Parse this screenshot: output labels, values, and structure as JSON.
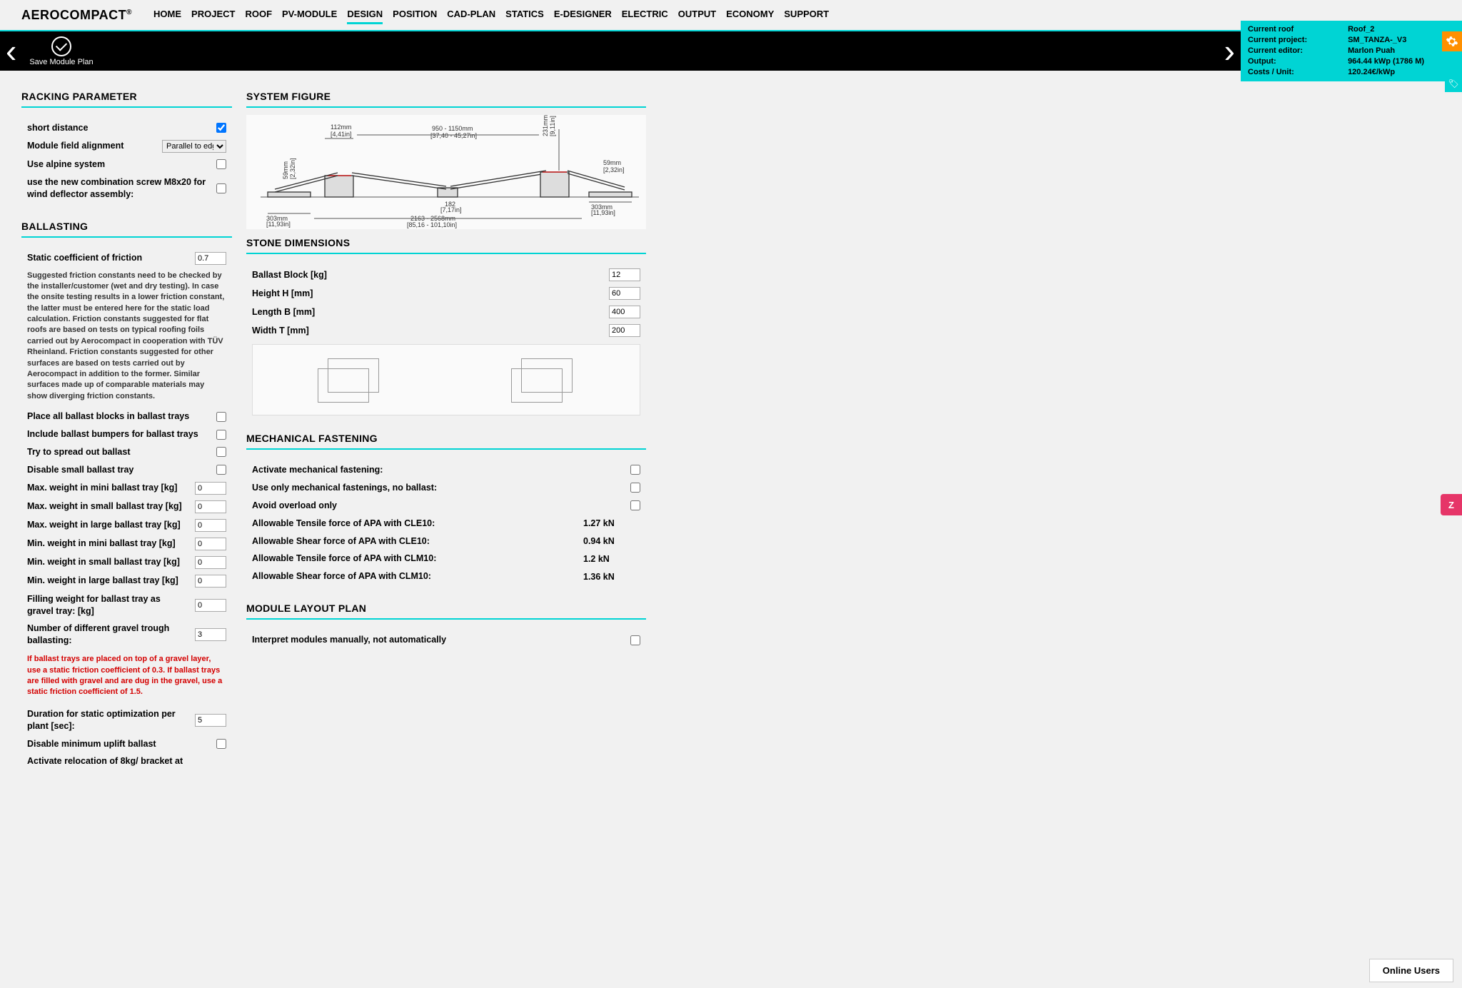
{
  "brand": "AEROCOMPACT",
  "nav": [
    "HOME",
    "PROJECT",
    "ROOF",
    "PV-MODULE",
    "DESIGN",
    "POSITION",
    "CAD-PLAN",
    "STATICS",
    "E-DESIGNER",
    "ELECTRIC",
    "OUTPUT",
    "ECONOMY",
    "SUPPORT"
  ],
  "nav_active": "DESIGN",
  "save_label": "Save Module Plan",
  "info": {
    "k_roof": "Current roof",
    "v_roof": "Roof_2",
    "k_project": "Current project:",
    "v_project": "SM_TANZA-_V3",
    "k_editor": "Current editor:",
    "v_editor": "Marlon Puah",
    "k_output": "Output:",
    "v_output": "964.44 kWp (1786 M)",
    "k_cost": "Costs / Unit:",
    "v_cost": "120.24€/kWp"
  },
  "sections": {
    "racking": "RACKING PARAMETER",
    "ballasting": "BALLASTING",
    "system_figure": "SYSTEM FIGURE",
    "stone": "STONE DIMENSIONS",
    "mech": "MECHANICAL FASTENING",
    "layout": "MODULE LAYOUT PLAN"
  },
  "racking": {
    "short_distance": "short distance",
    "short_distance_checked": true,
    "alignment": "Module field alignment",
    "alignment_value": "Parallel to edge",
    "alpine": "Use alpine system",
    "combo_screw": "use the new combination screw M8x20 for wind deflector assembly:"
  },
  "ballasting": {
    "friction_label": "Static coefficient of friction",
    "friction_value": "0.7",
    "help": "Suggested friction constants need to be checked by the installer/customer (wet and dry testing). In case the onsite testing results in a lower friction constant, the latter must be entered here for the static load calculation. Friction constants suggested for flat roofs are based on tests on typical roofing foils carried out by Aerocompact in cooperation with TÜV Rheinland. Friction constants suggested for other surfaces are based on tests carried out by Aerocompact in addition to the former. Similar surfaces made up of comparable materials may show diverging friction constants.",
    "place_in_trays": "Place all ballast blocks in ballast trays",
    "include_bumpers": "Include ballast bumpers for ballast trays",
    "spread": "Try to spread out ballast",
    "disable_small": "Disable small ballast tray",
    "max_mini": "Max. weight in mini ballast tray [kg]",
    "max_small": "Max. weight in small ballast tray [kg]",
    "max_large": "Max. weight in large ballast tray [kg]",
    "min_mini": "Min. weight in mini ballast tray [kg]",
    "min_small": "Min. weight in small ballast tray [kg]",
    "min_large": "Min. weight in large ballast tray [kg]",
    "filling": "Filling weight for ballast tray as gravel tray: [kg]",
    "trough_count": "Number of different gravel trough ballasting:",
    "trough_value": "3",
    "warn": "If ballast trays are placed on top of a gravel layer, use a static friction coefficient of 0.3. If ballast trays are filled with gravel and are dug in the gravel, use a static friction coefficient of 1.5.",
    "duration": "Duration for static optimization per plant [sec]:",
    "duration_value": "5",
    "disable_uplift": "Disable minimum uplift ballast",
    "relocation": "Activate relocation of 8kg/ bracket at",
    "zero": "0"
  },
  "figure": {
    "d_112": "112mm",
    "d_112in": "[4,41in]",
    "d_950": "950 - 1150mm",
    "d_950in": "[37,40 - 45,27in]",
    "d_231": "231mm",
    "d_231in": "[9,11in]",
    "d_59a": "59mm",
    "d_59ain": "[2,32in]",
    "d_59b": "59mm",
    "d_59bin": "[2,32in]",
    "d_303a": "303mm",
    "d_303ain": "[11,93in]",
    "d_303b": "303mm",
    "d_303bin": "[11,93in]",
    "d_182": "182",
    "d_182in": "[7,17in]",
    "d_2163": "2163 - 2568mm",
    "d_2163in": "[85,16 - 101,10in]"
  },
  "stone": {
    "block": "Ballast Block [kg]",
    "block_v": "12",
    "height": "Height H [mm]",
    "height_v": "60",
    "length": "Length B [mm]",
    "length_v": "400",
    "width": "Width T [mm]",
    "width_v": "200"
  },
  "mech": {
    "activate": "Activate mechanical fastening:",
    "only_mech": "Use only mechanical fastenings, no ballast:",
    "avoid": "Avoid overload only",
    "tensile_cle10": "Allowable Tensile force of APA with CLE10:",
    "tensile_cle10_v": "1.27 kN",
    "shear_cle10": "Allowable Shear force of APA with CLE10:",
    "shear_cle10_v": "0.94 kN",
    "tensile_clm10": "Allowable Tensile force of APA with CLM10:",
    "tensile_clm10_v": "1.2 kN",
    "shear_clm10": "Allowable Shear force of APA with CLM10:",
    "shear_clm10_v": "1.36 kN"
  },
  "layout": {
    "interpret": "Interpret modules manually, not automatically"
  },
  "online_users": "Online Users",
  "z": "Z"
}
